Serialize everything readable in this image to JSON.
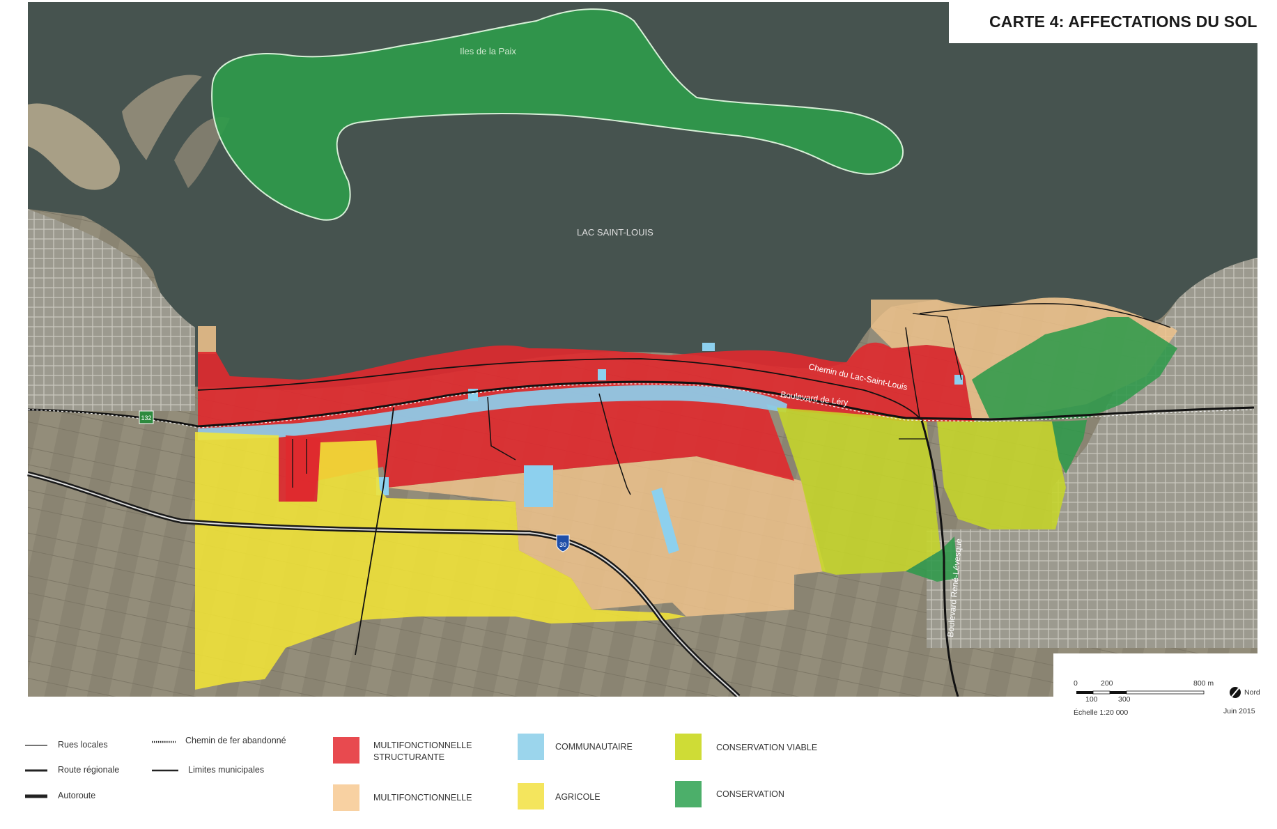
{
  "title": "CARTE 4: AFFECTATIONS DU SOL",
  "map_labels": {
    "islands": "Iles de la Paix",
    "lake": "LAC SAINT-LOUIS",
    "road_chemin": "Chemin du Lac-Saint-Louis",
    "road_boulevard_lery": "Boulevard de Léry",
    "road_boulevard_levesque": "Boulevard René-Lévesque",
    "shield_132": "132",
    "shield_30": "30"
  },
  "legend_lines": [
    {
      "label": "Rues locales",
      "style": "thin"
    },
    {
      "label": "Route régionale",
      "style": "medium"
    },
    {
      "label": "Autoroute",
      "style": "thick"
    },
    {
      "label": "Chemin de fer abandonné",
      "style": "rail"
    },
    {
      "label": "Limites municipales",
      "style": "boundary"
    }
  ],
  "legend_affectations": [
    {
      "label": "MULTIFONCTIONNELLE STRUCTURANTE",
      "line1": "MULTIFONCTIONNELLE",
      "line2": "STRUCTURANTE",
      "color": "#e84a4f"
    },
    {
      "label": "MULTIFONCTIONNELLE",
      "color": "#f8d1a2"
    },
    {
      "label": "COMMUNAUTAIRE",
      "color": "#9bd5ec"
    },
    {
      "label": "AGRICOLE",
      "color": "#f4e55d"
    },
    {
      "label": "CONSERVATION VIABLE",
      "color": "#cfdc36"
    },
    {
      "label": "CONSERVATION",
      "color": "#4caf6a"
    }
  ],
  "scale": {
    "top_ticks": [
      "0",
      "200",
      "800 m"
    ],
    "bottom_ticks": [
      "100",
      "300"
    ],
    "ratio": "Échelle 1:20 000",
    "north": "Nord",
    "date": "Juin 2015"
  },
  "colors": {
    "water": "#46534f",
    "land": "#8f8a78",
    "multi_struct": "#e0292e",
    "multi": "#f2c48c",
    "communautaire": "#8dd0ee",
    "agricole": "#f1e437",
    "cons_viable": "#c6d62a",
    "conservation": "#2f9a4b"
  }
}
